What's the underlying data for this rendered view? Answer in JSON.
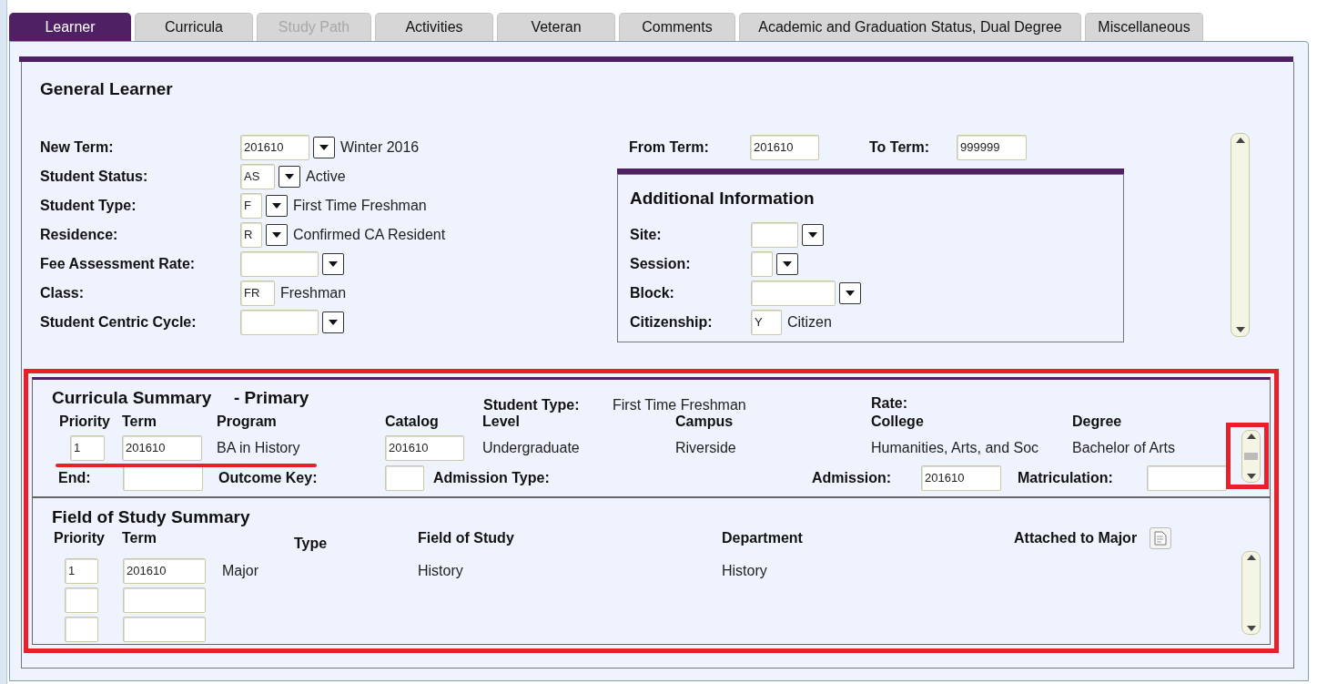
{
  "tabs": [
    {
      "label": "Learner",
      "selected": true,
      "disabled": false
    },
    {
      "label": "Curricula",
      "selected": false,
      "disabled": false
    },
    {
      "label": "Study Path",
      "selected": false,
      "disabled": true
    },
    {
      "label": "Activities",
      "selected": false,
      "disabled": false
    },
    {
      "label": "Veteran",
      "selected": false,
      "disabled": false
    },
    {
      "label": "Comments",
      "selected": false,
      "disabled": false
    },
    {
      "label": "Academic and Graduation Status, Dual Degree",
      "selected": false,
      "disabled": false
    },
    {
      "label": "Miscellaneous",
      "selected": false,
      "disabled": false
    }
  ],
  "general_learner": {
    "title": "General Learner",
    "fields": [
      {
        "label": "New Term:",
        "value": "201610",
        "kind": "lookup",
        "description": "Winter 2016"
      },
      {
        "label": "Student Status:",
        "value": "AS",
        "kind": "lookup",
        "description": "Active"
      },
      {
        "label": "Student Type:",
        "value": "F",
        "kind": "lookup",
        "description": "First Time Freshman"
      },
      {
        "label": "Residence:",
        "value": "R",
        "kind": "lookup",
        "description": "Confirmed CA Resident"
      },
      {
        "label": "Fee Assessment Rate:",
        "kind": "lookup"
      },
      {
        "label": "Class:",
        "value": "FR",
        "kind": "text",
        "description": "Freshman"
      },
      {
        "label": "Student Centric Cycle:",
        "kind": "lookup"
      }
    ],
    "from_term": {
      "label": "From Term:",
      "value": "201610"
    },
    "to_term": {
      "label": "To Term:",
      "value": "999999"
    },
    "additional_information": {
      "title": "Additional Information",
      "fields": [
        {
          "label": "Site:",
          "kind": "lookup"
        },
        {
          "label": "Session:",
          "kind": "lookup"
        },
        {
          "label": "Block:",
          "kind": "lookup"
        },
        {
          "label": "Citizenship:",
          "value": "Y",
          "kind": "text",
          "description": "Citizen"
        }
      ]
    }
  },
  "curricula_summary": {
    "title": "Curricula Summary",
    "subtitle": "- Primary",
    "student_type_label": "Student Type:",
    "student_type_value": "First Time Freshman",
    "rate_label": "Rate:",
    "columns": [
      "Priority",
      "Term",
      "Program",
      "Catalog",
      "Level",
      "Campus",
      "College",
      "Degree"
    ],
    "row": {
      "priority": "1",
      "term": "201610",
      "program": "BA in History",
      "catalog": "201610",
      "level": "Undergraduate",
      "campus": "Riverside",
      "college": "Humanities, Arts, and Soc",
      "degree": "Bachelor of Arts"
    },
    "end_label": "End:",
    "outcome_key_label": "Outcome Key:",
    "admission_type_label": "Admission Type:",
    "admission_label": "Admission:",
    "admission_value": "201610",
    "matriculation_label": "Matriculation:"
  },
  "field_of_study_summary": {
    "title": "Field of Study Summary",
    "columns": [
      "Priority",
      "Term",
      "Type",
      "Field of Study",
      "Department"
    ],
    "attached_label": "Attached to Major",
    "rows": [
      {
        "priority": "1",
        "term": "201610",
        "type": "Major",
        "field_of_study": "History",
        "department": "History"
      }
    ]
  }
}
